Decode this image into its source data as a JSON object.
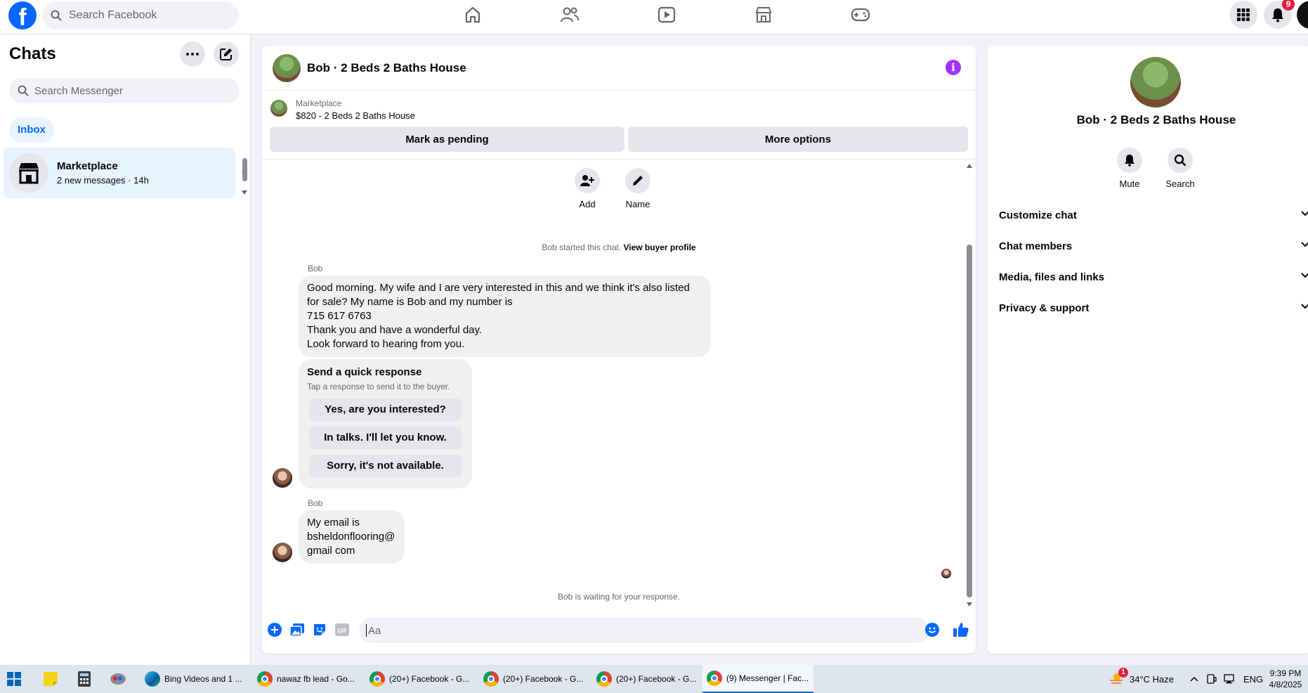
{
  "colors": {
    "brand": "#0866ff",
    "badge": "#e41e3f",
    "info": "#a033ff",
    "inbox_bg": "#e7f3ff"
  },
  "topbar": {
    "search_placeholder": "Search Facebook",
    "nav_icons": [
      "home-icon",
      "friends-icon",
      "video-icon",
      "marketplace-icon",
      "gaming-icon"
    ],
    "notification_count": "9"
  },
  "sidebar": {
    "title": "Chats",
    "search_placeholder": "Search Messenger",
    "filter": "Inbox",
    "chats": [
      {
        "name": "Marketplace",
        "preview": "2 new messages",
        "time": "14h"
      }
    ]
  },
  "chat": {
    "title": "Bob · 2 Beds 2 Baths House",
    "marketplace_label": "Marketplace",
    "listing": "$820 - 2 Beds 2 Baths House",
    "mark_pending": "Mark as pending",
    "more_options": "More options",
    "add_label": "Add",
    "name_label": "Name",
    "started_text": "Bob started this chat.",
    "buyer_profile_link": "View buyer profile",
    "messages": [
      {
        "sender": "Bob",
        "lines": [
          "Good morning. My wife and I are very interested in this and we think it's also listed",
          "for sale? My name is Bob and my number is",
          "715 617 6763",
          "Thank you and have a wonderful day.",
          "Look forward to hearing from you."
        ]
      },
      {
        "sender": "Bob",
        "lines": [
          "My email is",
          "bsheldonflooring@",
          "gmail com"
        ]
      }
    ],
    "quick_response": {
      "title": "Send a quick response",
      "subtitle": "Tap a response to send it to the buyer.",
      "options": [
        "Yes, are you interested?",
        "In talks. I'll let you know.",
        "Sorry, it's not available."
      ]
    },
    "waiting_text": "Bob is waiting for your response.",
    "composer_placeholder": "Aa"
  },
  "panel": {
    "name": "Bob · 2 Beds 2 Baths House",
    "mute": "Mute",
    "search": "Search",
    "sections": [
      "Customize chat",
      "Chat members",
      "Media, files and links",
      "Privacy & support"
    ]
  },
  "taskbar": {
    "apps": [
      {
        "label": "Bing Videos and 1 ...",
        "icon": "edge-icon"
      },
      {
        "label": "nawaz fb lead - Go...",
        "icon": "chrome-icon"
      },
      {
        "label": "(20+) Facebook - G...",
        "icon": "chrome-icon"
      },
      {
        "label": "(20+) Facebook - G...",
        "icon": "chrome-icon"
      },
      {
        "label": "(20+) Facebook - G...",
        "icon": "chrome-icon"
      },
      {
        "label": "(9) Messenger | Fac...",
        "icon": "chrome-icon"
      }
    ],
    "weather": "34°C  Haze",
    "weather_badge": "1",
    "language": "ENG",
    "time": "9:39 PM",
    "date": "4/8/2025"
  }
}
